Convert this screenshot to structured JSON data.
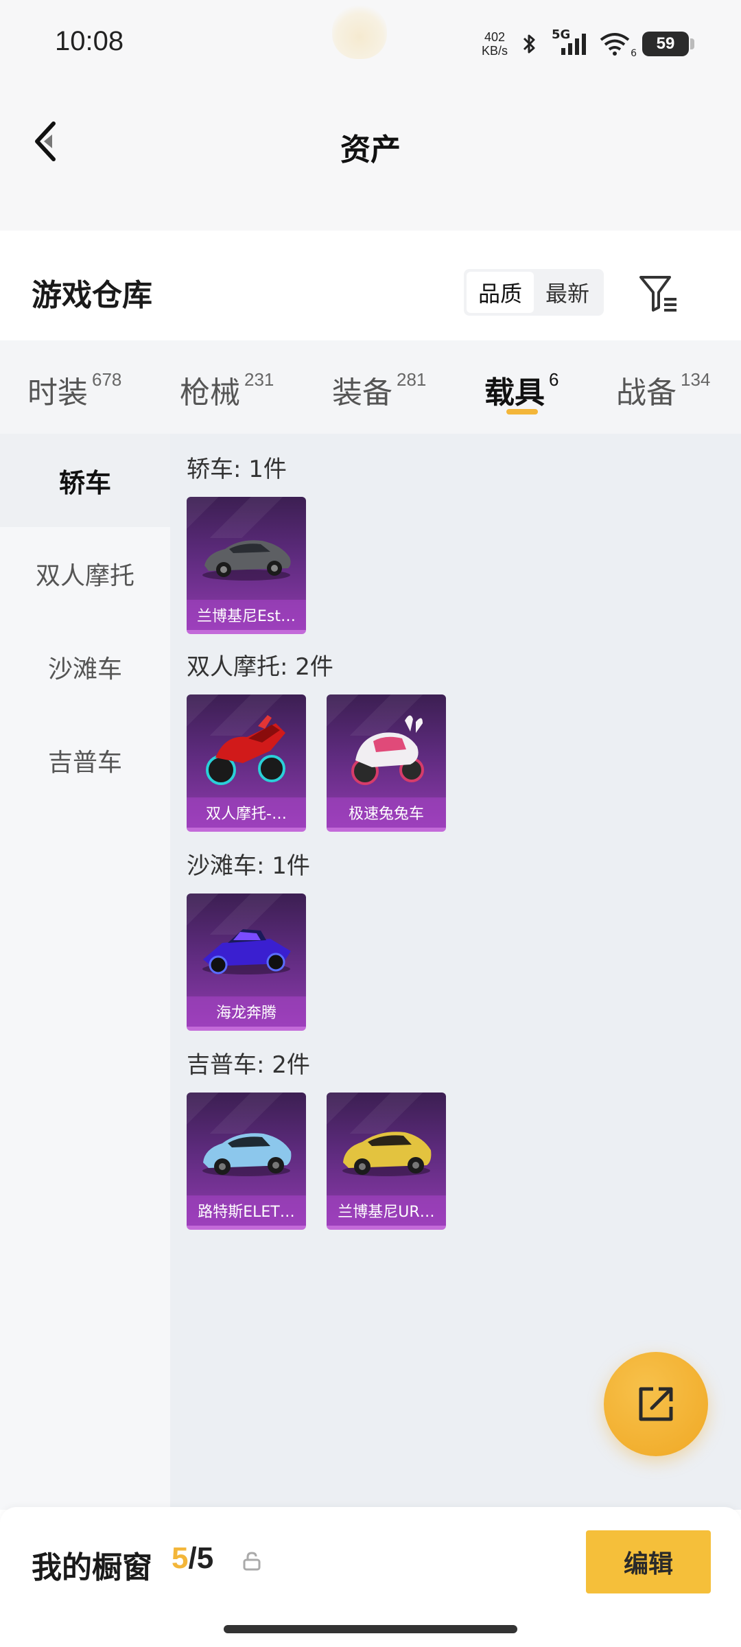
{
  "status_bar": {
    "time": "10:08",
    "net_speed_value": "402",
    "net_speed_unit": "KB/s",
    "signal_label": "5G",
    "wifi_badge": "6",
    "battery": "59"
  },
  "header": {
    "title": "资产"
  },
  "warehouse": {
    "title": "游戏仓库",
    "sort_options": [
      {
        "label": "品质",
        "active": true
      },
      {
        "label": "最新",
        "active": false
      }
    ]
  },
  "tabs": [
    {
      "label": "时装",
      "count": "678"
    },
    {
      "label": "枪械",
      "count": "231"
    },
    {
      "label": "装备",
      "count": "281"
    },
    {
      "label": "载具",
      "count": "6",
      "active": true
    },
    {
      "label": "战备",
      "count": "134"
    }
  ],
  "sidebar": {
    "items": [
      {
        "label": "轿车",
        "active": true
      },
      {
        "label": "双人摩托"
      },
      {
        "label": "沙滩车"
      },
      {
        "label": "吉普车"
      }
    ]
  },
  "groups": [
    {
      "title": "轿车: 1件",
      "items": [
        {
          "label": "兰博基尼Est…",
          "icon": "sedan-car-icon"
        }
      ]
    },
    {
      "title": "双人摩托: 2件",
      "items": [
        {
          "label": "双人摩托-…",
          "icon": "motorcycle-icon"
        },
        {
          "label": "极速兔兔车",
          "icon": "bunny-motorcycle-icon"
        }
      ]
    },
    {
      "title": "沙滩车: 1件",
      "items": [
        {
          "label": "海龙奔腾",
          "icon": "buggy-icon"
        }
      ]
    },
    {
      "title": "吉普车: 2件",
      "items": [
        {
          "label": "路特斯ELET…",
          "icon": "suv-blue-icon"
        },
        {
          "label": "兰博基尼UR…",
          "icon": "suv-yellow-icon"
        }
      ]
    }
  ],
  "showcase": {
    "title": "我的橱窗",
    "current": "5",
    "separator": "/",
    "total": "5",
    "edit_label": "编辑"
  },
  "colors": {
    "accent": "#f3b63a",
    "card_purple": "#8e3aac"
  }
}
